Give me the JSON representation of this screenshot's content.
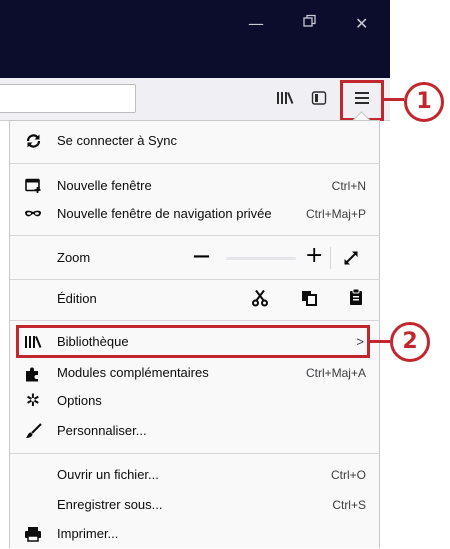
{
  "window": {
    "minimize_icon": "minimize-icon",
    "restore_icon": "restore-icon",
    "close_icon": "close-icon"
  },
  "toolbar": {
    "library_icon": "library-icon",
    "sidebar_icon": "sidebar-icon",
    "menu_icon": "hamburger-menu-icon"
  },
  "callouts": {
    "first": "1",
    "second": "2"
  },
  "menu": {
    "sync": "Se connecter à Sync",
    "new_window": "Nouvelle fenêtre",
    "new_window_shortcut": "Ctrl+N",
    "private_window": "Nouvelle fenêtre de navigation privée",
    "private_window_shortcut": "Ctrl+Maj+P",
    "zoom": "Zoom",
    "zoom_minus": "—",
    "zoom_plus": "+",
    "edit": "Édition",
    "library": "Bibliothèque",
    "library_arrow": ">",
    "addons": "Modules complémentaires",
    "addons_shortcut": "Ctrl+Maj+A",
    "options": "Options",
    "customize": "Personnaliser...",
    "open_file": "Ouvrir un fichier...",
    "open_file_shortcut": "Ctrl+O",
    "save_as": "Enregistrer sous...",
    "save_as_shortcut": "Ctrl+S",
    "print": "Imprimer..."
  },
  "colors": {
    "title_bar": "#0c0c2c",
    "highlight": "#c1272d",
    "menu_bg": "#f9f9fa"
  }
}
